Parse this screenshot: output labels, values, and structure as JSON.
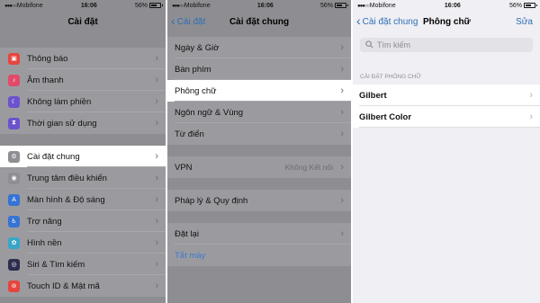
{
  "status": {
    "left": {
      "carrier": "Mobifone",
      "time": "16:06",
      "battery": "56%"
    },
    "middle": {
      "carrier": "Mobifone",
      "time": "16:06",
      "battery": "56%"
    },
    "right": {
      "carrier": "Mobifone",
      "time": "16:06",
      "battery": "56%"
    }
  },
  "settings": {
    "title": "Cài đặt",
    "group1": [
      {
        "label": "Thông báo",
        "icon": "notifications-icon",
        "color": "#e6453e"
      },
      {
        "label": "Âm thanh",
        "icon": "sound-icon",
        "color": "#e24a69"
      },
      {
        "label": "Không làm phiền",
        "icon": "moon-icon",
        "color": "#6c52cf"
      },
      {
        "label": "Thời gian sử dụng",
        "icon": "hourglass-icon",
        "color": "#6c52cf"
      }
    ],
    "group2": [
      {
        "label": "Cài đặt chung",
        "icon": "gear-icon",
        "color": "#8e8e93",
        "selected": true
      },
      {
        "label": "Trung tâm điều khiển",
        "icon": "control-center-icon",
        "color": "#8e8e93"
      },
      {
        "label": "Màn hình & Độ sáng",
        "icon": "display-icon",
        "color": "#3574d4"
      },
      {
        "label": "Trợ năng",
        "icon": "accessibility-icon",
        "color": "#3574d4"
      },
      {
        "label": "Hình nền",
        "icon": "wallpaper-icon",
        "color": "#37a6c9"
      },
      {
        "label": "Siri & Tìm kiếm",
        "icon": "siri-icon",
        "color": "#2d2d50"
      },
      {
        "label": "Touch ID & Mật mã",
        "icon": "fingerprint-icon",
        "color": "#e6453e"
      }
    ]
  },
  "general": {
    "back": "Cài đặt",
    "title": "Cài đặt chung",
    "group1": [
      {
        "label": "Ngày & Giờ"
      },
      {
        "label": "Bàn phím"
      },
      {
        "label": "Phông chữ",
        "selected": true
      },
      {
        "label": "Ngôn ngữ & Vùng"
      },
      {
        "label": "Từ điển"
      }
    ],
    "vpn": {
      "label": "VPN",
      "detail": "Không Kết nối"
    },
    "legal": {
      "label": "Pháp lý & Quy định"
    },
    "reset": {
      "label": "Đặt lại"
    },
    "shutdown": {
      "label": "Tắt máy"
    }
  },
  "fonts": {
    "back": "Cài đặt chung",
    "title": "Phông chữ",
    "edit": "Sửa",
    "search_placeholder": "Tìm kiếm",
    "section": "CÀI ĐẶT PHÔNG CHỮ",
    "items": [
      "Gilbert",
      "Gilbert Color"
    ]
  }
}
